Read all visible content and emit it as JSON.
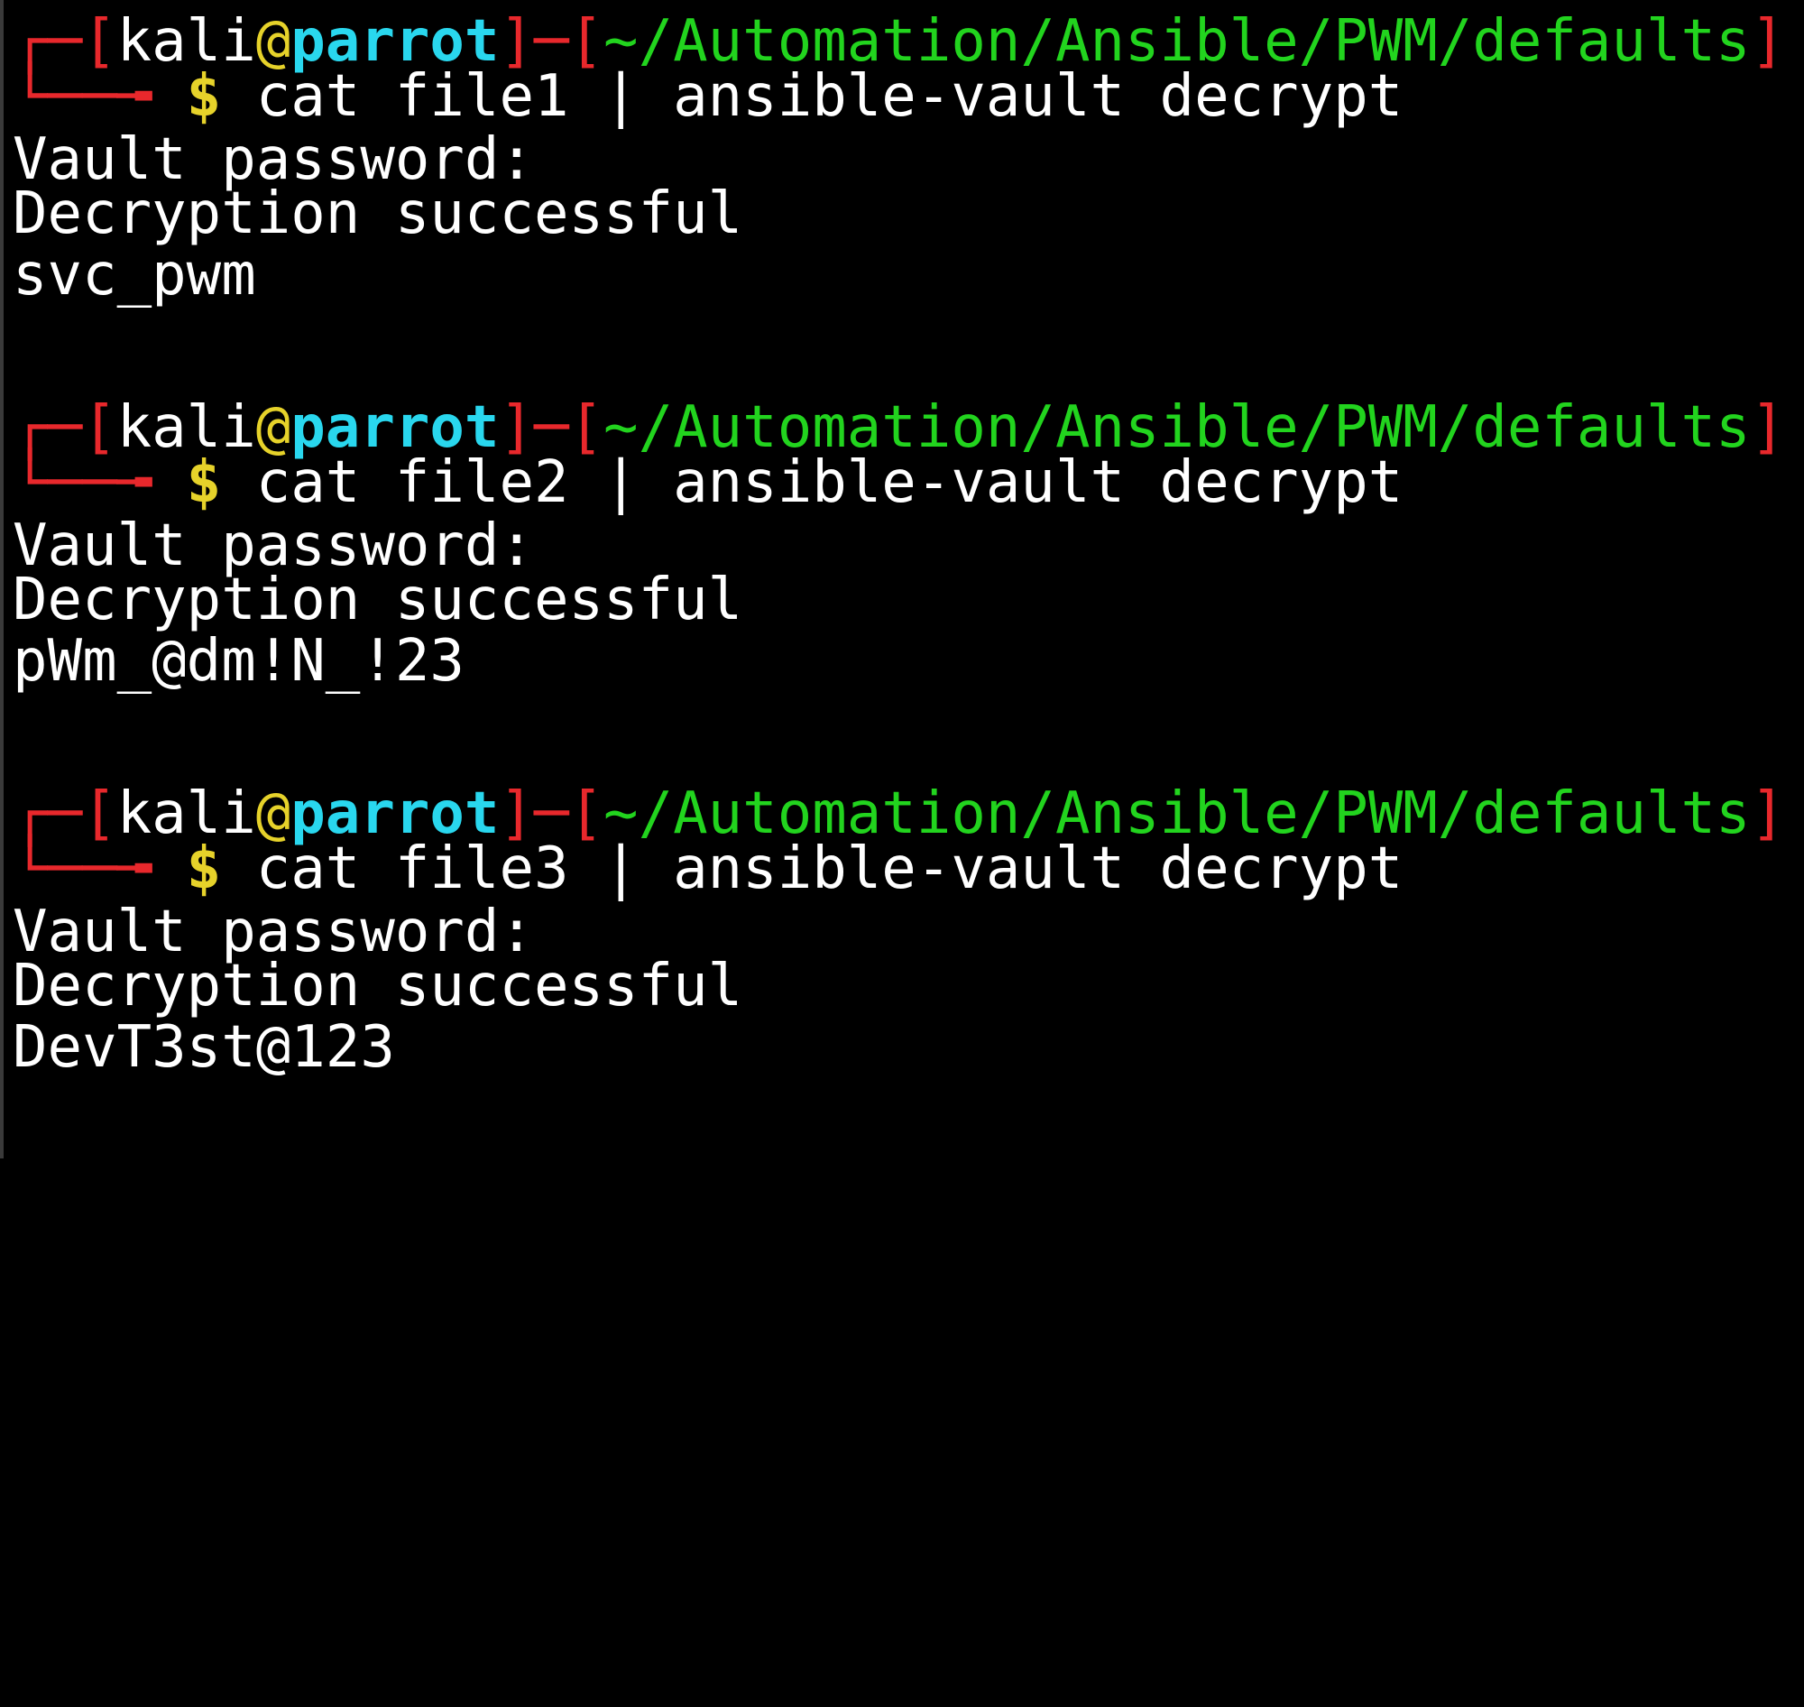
{
  "terminal": {
    "colors": {
      "background": "#000000",
      "bracket": "#e8282c",
      "at": "#e6d22a",
      "host": "#29d7ee",
      "path": "#22d41e",
      "dollar": "#e6d22a",
      "text": "#ffffff"
    },
    "blocks": [
      {
        "prompt": {
          "corner": "┌─",
          "lb1": "[",
          "user": "kali",
          "at": "@",
          "host": "parrot",
          "rb1": "]",
          "sep": "─",
          "lb2": "[",
          "path": "~/Automation/Ansible/PWM/defaults",
          "rb2": "]",
          "tail": "└──╼",
          "dollar": "$",
          "command": "cat file1 | ansible-vault decrypt"
        },
        "output": [
          "Vault password:",
          "Decryption successful",
          "svc_pwm"
        ]
      },
      {
        "prompt": {
          "corner": "┌─",
          "lb1": "[",
          "user": "kali",
          "at": "@",
          "host": "parrot",
          "rb1": "]",
          "sep": "─",
          "lb2": "[",
          "path": "~/Automation/Ansible/PWM/defaults",
          "rb2": "]",
          "tail": "└──╼",
          "dollar": "$",
          "command": "cat file2 | ansible-vault decrypt"
        },
        "output": [
          "Vault password:",
          "Decryption successful",
          "pWm_@dm!N_!23"
        ]
      },
      {
        "prompt": {
          "corner": "┌─",
          "lb1": "[",
          "user": "kali",
          "at": "@",
          "host": "parrot",
          "rb1": "]",
          "sep": "─",
          "lb2": "[",
          "path": "~/Automation/Ansible/PWM/defaults",
          "rb2": "]",
          "tail": "└──╼",
          "dollar": "$",
          "command": "cat file3 | ansible-vault decrypt"
        },
        "output": [
          "Vault password:",
          "Decryption successful",
          "DevT3st@123"
        ]
      }
    ]
  }
}
